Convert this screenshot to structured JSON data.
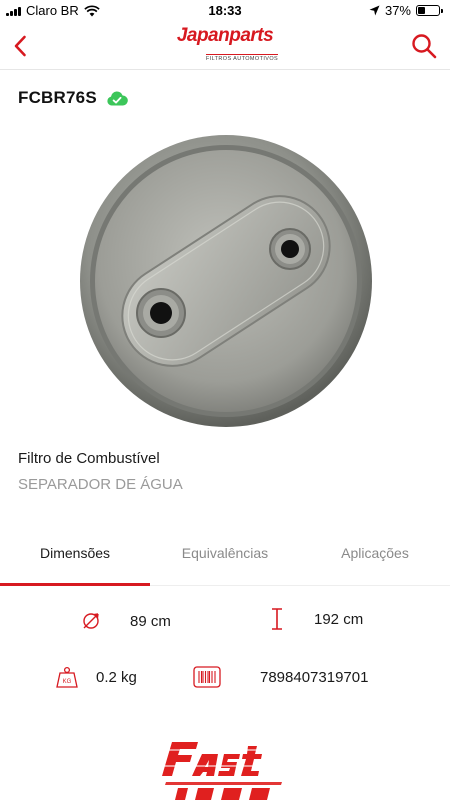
{
  "status_bar": {
    "carrier": "Claro BR",
    "time": "18:33",
    "battery_percent": "37%",
    "battery_level": 0.37
  },
  "nav": {
    "brand_name": "Japanparts",
    "brand_tagline": "FILTROS AUTOMOTIVOS"
  },
  "product": {
    "code": "FCBR76S",
    "name": "Filtro de Combustível",
    "subtitle": "SEPARADOR DE ÁGUA"
  },
  "tabs": [
    {
      "label": "Dimensões",
      "active": true
    },
    {
      "label": "Equivalências",
      "active": false
    },
    {
      "label": "Aplicações",
      "active": false
    }
  ],
  "specs": {
    "diameter": "89 cm",
    "height": "192 cm",
    "weight": "0.2 kg",
    "barcode": "7898407319701"
  },
  "icons": {
    "back": "chevron-left-icon",
    "search": "search-icon",
    "cloud": "cloud-check-icon",
    "diameter": "diameter-icon",
    "height": "height-icon",
    "weight": "weight-icon",
    "barcode": "barcode-icon"
  },
  "colors": {
    "accent": "#d71920",
    "cloud": "#3cc65a"
  }
}
